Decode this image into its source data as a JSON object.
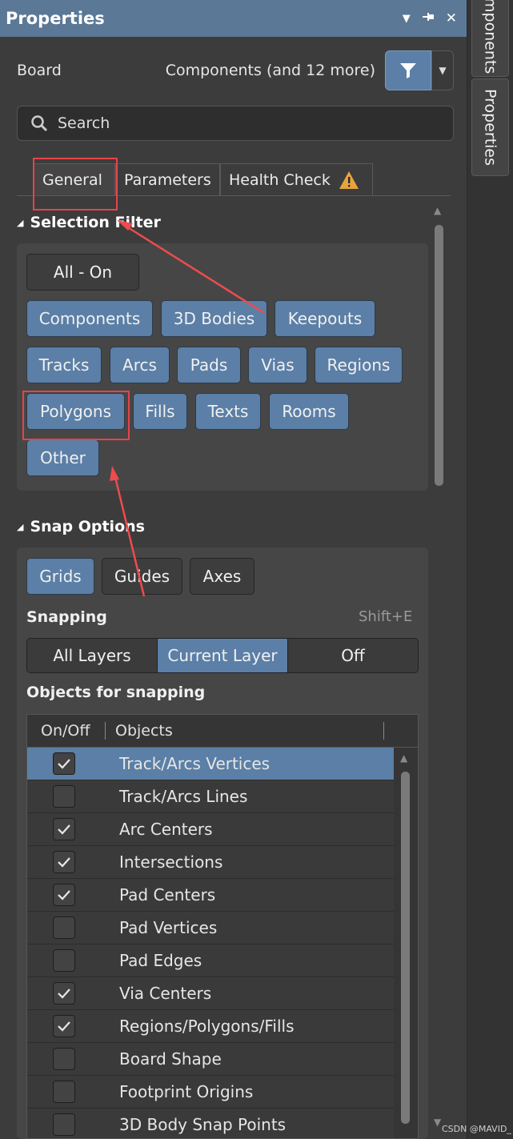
{
  "panel": {
    "title": "Properties"
  },
  "window_controls": {
    "dropdown_icon": "▼",
    "pin_icon": "pin",
    "close_icon": "✕"
  },
  "side_tabs": [
    "mponents",
    "Properties"
  ],
  "filter_row": {
    "label": "Board",
    "components_text": "Components (and 12 more)"
  },
  "search": {
    "placeholder": "Search"
  },
  "tabs": [
    {
      "label": "General",
      "active": true
    },
    {
      "label": "Parameters",
      "active": false
    },
    {
      "label": "Health Check",
      "warning": true
    }
  ],
  "selection_filter": {
    "heading": "Selection Filter",
    "all_on": "All - On",
    "buttons": [
      "Components",
      "3D Bodies",
      "Keepouts",
      "Tracks",
      "Arcs",
      "Pads",
      "Vias",
      "Regions",
      "Polygons",
      "Fills",
      "Texts",
      "Rooms",
      "Other"
    ]
  },
  "snap_options": {
    "heading": "Snap Options",
    "grids": "Grids",
    "guides": "Guides",
    "axes": "Axes",
    "snapping_label": "Snapping",
    "shortcut": "Shift+E",
    "segments": [
      "All Layers",
      "Current Layer",
      "Off"
    ],
    "objects_label": "Objects for snapping",
    "table_headers": [
      "On/Off",
      "Objects"
    ],
    "rows": [
      {
        "name": "Track/Arcs Vertices",
        "checked": true,
        "selected": true
      },
      {
        "name": "Track/Arcs Lines",
        "checked": false
      },
      {
        "name": "Arc Centers",
        "checked": true
      },
      {
        "name": "Intersections",
        "checked": true
      },
      {
        "name": "Pad Centers",
        "checked": true
      },
      {
        "name": "Pad Vertices",
        "checked": false
      },
      {
        "name": "Pad Edges",
        "checked": false
      },
      {
        "name": "Via Centers",
        "checked": true
      },
      {
        "name": "Regions/Polygons/Fills",
        "checked": true
      },
      {
        "name": "Board Shape",
        "checked": false
      },
      {
        "name": "Footprint Origins",
        "checked": false
      },
      {
        "name": "3D Body Snap Points",
        "checked": false
      }
    ]
  },
  "watermark": "CSDN @MAVID_"
}
